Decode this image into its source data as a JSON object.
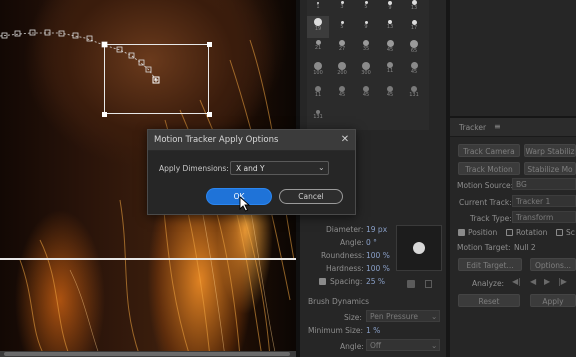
{
  "dialog": {
    "title": "Motion Tracker Apply Options",
    "close_glyph": "✕",
    "apply_dimensions_label": "Apply Dimensions:",
    "apply_dimensions_value": "X and Y",
    "ok_label": "OK",
    "cancel_label": "Cancel"
  },
  "brushes": {
    "row_labels": [
      [
        "1",
        "3",
        "5",
        "9",
        "13"
      ],
      [
        "19",
        "5",
        "9",
        "13",
        "17"
      ],
      [
        "21",
        "27",
        "35",
        "45",
        "65"
      ],
      [
        "100",
        "200",
        "300",
        "11",
        "45"
      ],
      [
        "11",
        "45",
        "45",
        "45",
        "131"
      ],
      [
        "131"
      ]
    ],
    "diameter_label": "Diameter:",
    "diameter_value": "19 px",
    "angle_label": "Angle:",
    "angle_value": "0 °",
    "roundness_label": "Roundness:",
    "roundness_value": "100 %",
    "hardness_label": "Hardness:",
    "hardness_value": "100 %",
    "spacing_label": "Spacing:",
    "spacing_value": "25 %",
    "dynamics_label": "Brush Dynamics",
    "size_label": "Size:",
    "size_value": "Pen Pressure",
    "min_size_label": "Minimum Size:",
    "min_size_value": "1 %",
    "angle2_label": "Angle:",
    "angle2_value": "Off"
  },
  "tracker": {
    "title": "Tracker",
    "menu_glyph": "≡",
    "track_camera": "Track Camera",
    "warp_stabilizer": "Warp Stabiliz",
    "track_motion": "Track Motion",
    "stabilize_motion": "Stabilize Mo",
    "motion_source_label": "Motion Source:",
    "motion_source_value": "BG",
    "current_track_label": "Current Track:",
    "current_track_value": "Tracker 1",
    "track_type_label": "Track Type:",
    "track_type_value": "Transform",
    "position_label": "Position",
    "rotation_label": "Rotation",
    "scale_label": "Sc",
    "motion_target_label": "Motion Target:",
    "motion_target_value": "Null 2",
    "edit_target": "Edit Target...",
    "options": "Options...",
    "analyze_label": "Analyze:",
    "reset": "Reset",
    "apply": "Apply"
  },
  "icons": [
    "close-icon",
    "chevron-down-icon",
    "cursor-arrow-icon",
    "menu-icon",
    "step-back-icon",
    "play-back-icon",
    "play-forward-icon",
    "step-forward-icon",
    "track-point-icon"
  ]
}
